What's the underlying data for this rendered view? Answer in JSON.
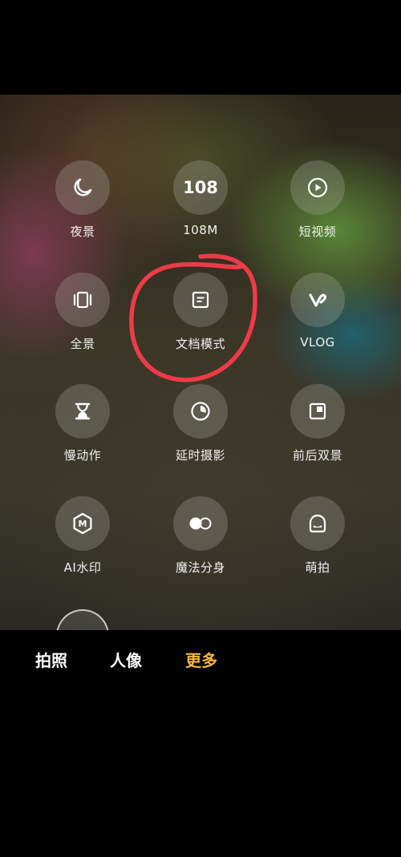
{
  "modes": [
    {
      "id": "night",
      "icon": "moon-icon",
      "label": "夜景"
    },
    {
      "id": "108m",
      "icon": "108-badge-icon",
      "icon_text": "108",
      "label": "108M"
    },
    {
      "id": "short-video",
      "icon": "play-icon",
      "label": "短视频"
    },
    {
      "id": "panorama",
      "icon": "panorama-icon",
      "label": "全景"
    },
    {
      "id": "document",
      "icon": "document-icon",
      "label": "文档模式"
    },
    {
      "id": "vlog",
      "icon": "vlog-icon",
      "label": "VLOG"
    },
    {
      "id": "slow-motion",
      "icon": "hourglass-icon",
      "label": "慢动作"
    },
    {
      "id": "timelapse",
      "icon": "timer-icon",
      "label": "延时摄影"
    },
    {
      "id": "dual",
      "icon": "dual-view-icon",
      "label": "前后双景"
    },
    {
      "id": "ai-watermark",
      "icon": "ai-watermark-icon",
      "icon_text": "M",
      "label": "AI水印"
    },
    {
      "id": "clone",
      "icon": "clone-icon",
      "label": "魔法分身"
    },
    {
      "id": "cute-shot",
      "icon": "cute-face-icon",
      "label": "萌拍"
    }
  ],
  "tabs": [
    {
      "label": "拍照",
      "active": false
    },
    {
      "label": "人像",
      "active": false
    },
    {
      "label": "更多",
      "active": true
    }
  ],
  "colors": {
    "active_tab": "#f5b638",
    "annotation_stroke": "#f03a4a",
    "background": "#000000"
  }
}
